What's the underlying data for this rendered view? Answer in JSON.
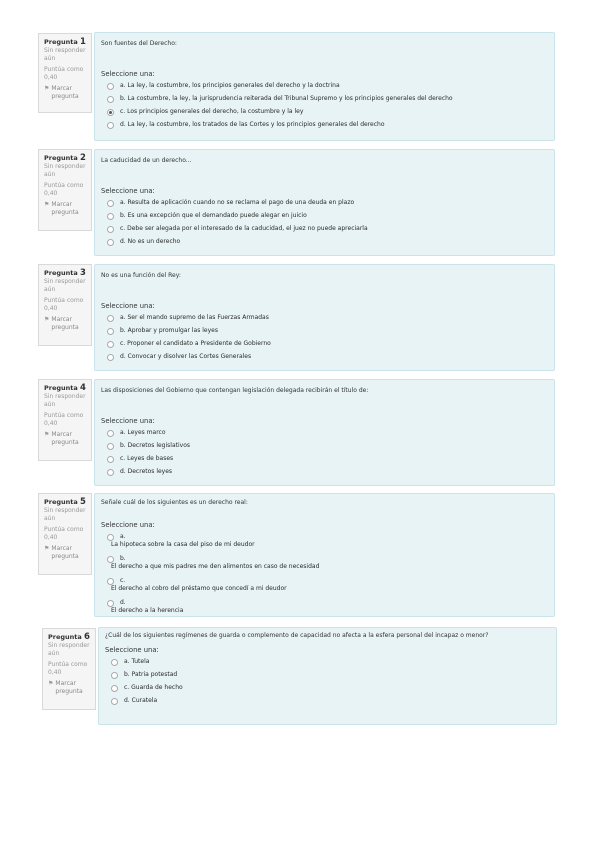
{
  "common": {
    "state": "Sin responder aún",
    "grade": "Puntúa como 0,40",
    "flag": "Marcar pregunta",
    "prompt": "Seleccione una:"
  },
  "questions": [
    {
      "label": "Pregunta",
      "number": "1",
      "text": "Son fuentes del Derecho:",
      "options": [
        {
          "text": "a. La ley, la costumbre, los principios generales del derecho y la doctrina",
          "selected": false
        },
        {
          "text": "b. La costumbre, la ley, la jurisprudencia reiterada del Tribunal Supremo y los principios generales del derecho",
          "selected": false
        },
        {
          "text": "c. Los principios generales del derecho, la costumbre y la ley",
          "selected": true
        },
        {
          "text": "d. La ley, la costumbre, los tratados de las Cortes y los principios generales del derecho",
          "selected": false
        }
      ]
    },
    {
      "label": "Pregunta",
      "number": "2",
      "text": "La caducidad de un derecho...",
      "options": [
        {
          "text": "a. Resulta de aplicación cuando no se reclama el pago de una deuda en plazo",
          "selected": false
        },
        {
          "text": "b. Es una excepción que el demandado puede alegar en juicio",
          "selected": false
        },
        {
          "text": "c. Debe ser alegada por el interesado de la caducidad, el juez no puede apreciarla",
          "selected": false
        },
        {
          "text": "d. No es un derecho",
          "selected": false
        }
      ]
    },
    {
      "label": "Pregunta",
      "number": "3",
      "text": "No es una función del Rey:",
      "options": [
        {
          "text": "a. Ser el mando supremo de las Fuerzas Armadas",
          "selected": false
        },
        {
          "text": "b. Aprobar y promulgar las leyes",
          "selected": false
        },
        {
          "text": "c. Proponer el candidato a Presidente de Gobierno",
          "selected": false
        },
        {
          "text": "d. Convocar y disolver las Cortes Generales",
          "selected": false
        }
      ]
    },
    {
      "label": "Pregunta",
      "number": "4",
      "text": "Las disposiciones del Gobierno que contengan legislación delegada recibirán el título de:",
      "options": [
        {
          "text": "a. Leyes marco",
          "selected": false
        },
        {
          "text": "b. Decretos legislativos",
          "selected": false
        },
        {
          "text": "c. Leyes de bases",
          "selected": false
        },
        {
          "text": "d. Decretos leyes",
          "selected": false
        }
      ]
    },
    {
      "label": "Pregunta",
      "number": "5",
      "text": "Señale cuál de los siguientes es un derecho real:",
      "options": [
        {
          "letter": "a.",
          "text": "La hipoteca sobre la casa del piso de mi deudor",
          "selected": false
        },
        {
          "letter": "b.",
          "text": "El derecho a que mis padres me den alimentos en caso de necesidad",
          "selected": false
        },
        {
          "letter": "c.",
          "text": "El derecho al cobro del préstamo que concedí a mi deudor",
          "selected": false
        },
        {
          "letter": "d.",
          "text": "El derecho a la herencia",
          "selected": false
        }
      ]
    },
    {
      "label": "Pregunta",
      "number": "6",
      "text": "¿Cuál de los siguientes regímenes de guarda o complemento de capacidad no afecta a la esfera personal del incapaz o menor?",
      "options": [
        {
          "text": "a. Tutela",
          "selected": false
        },
        {
          "text": "b. Patria potestad",
          "selected": false
        },
        {
          "text": "c. Guarda de hecho",
          "selected": false
        },
        {
          "text": "d. Curatela",
          "selected": false
        }
      ]
    }
  ]
}
